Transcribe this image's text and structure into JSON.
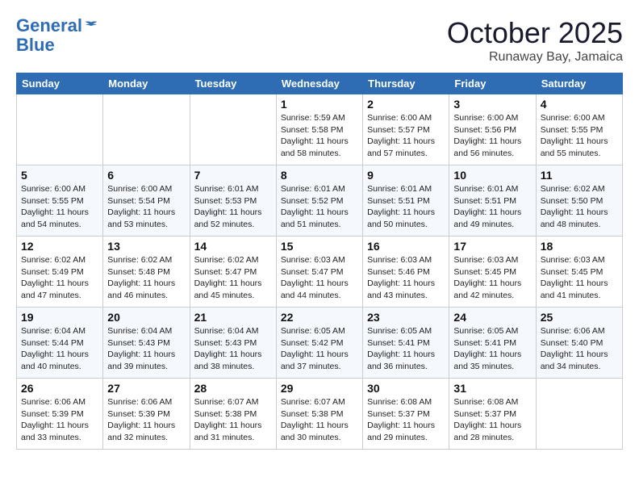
{
  "header": {
    "logo_line1": "General",
    "logo_line2": "Blue",
    "month": "October 2025",
    "location": "Runaway Bay, Jamaica"
  },
  "weekdays": [
    "Sunday",
    "Monday",
    "Tuesday",
    "Wednesday",
    "Thursday",
    "Friday",
    "Saturday"
  ],
  "weeks": [
    [
      {
        "day": "",
        "info": ""
      },
      {
        "day": "",
        "info": ""
      },
      {
        "day": "",
        "info": ""
      },
      {
        "day": "1",
        "info": "Sunrise: 5:59 AM\nSunset: 5:58 PM\nDaylight: 11 hours and 58 minutes."
      },
      {
        "day": "2",
        "info": "Sunrise: 6:00 AM\nSunset: 5:57 PM\nDaylight: 11 hours and 57 minutes."
      },
      {
        "day": "3",
        "info": "Sunrise: 6:00 AM\nSunset: 5:56 PM\nDaylight: 11 hours and 56 minutes."
      },
      {
        "day": "4",
        "info": "Sunrise: 6:00 AM\nSunset: 5:55 PM\nDaylight: 11 hours and 55 minutes."
      }
    ],
    [
      {
        "day": "5",
        "info": "Sunrise: 6:00 AM\nSunset: 5:55 PM\nDaylight: 11 hours and 54 minutes."
      },
      {
        "day": "6",
        "info": "Sunrise: 6:00 AM\nSunset: 5:54 PM\nDaylight: 11 hours and 53 minutes."
      },
      {
        "day": "7",
        "info": "Sunrise: 6:01 AM\nSunset: 5:53 PM\nDaylight: 11 hours and 52 minutes."
      },
      {
        "day": "8",
        "info": "Sunrise: 6:01 AM\nSunset: 5:52 PM\nDaylight: 11 hours and 51 minutes."
      },
      {
        "day": "9",
        "info": "Sunrise: 6:01 AM\nSunset: 5:51 PM\nDaylight: 11 hours and 50 minutes."
      },
      {
        "day": "10",
        "info": "Sunrise: 6:01 AM\nSunset: 5:51 PM\nDaylight: 11 hours and 49 minutes."
      },
      {
        "day": "11",
        "info": "Sunrise: 6:02 AM\nSunset: 5:50 PM\nDaylight: 11 hours and 48 minutes."
      }
    ],
    [
      {
        "day": "12",
        "info": "Sunrise: 6:02 AM\nSunset: 5:49 PM\nDaylight: 11 hours and 47 minutes."
      },
      {
        "day": "13",
        "info": "Sunrise: 6:02 AM\nSunset: 5:48 PM\nDaylight: 11 hours and 46 minutes."
      },
      {
        "day": "14",
        "info": "Sunrise: 6:02 AM\nSunset: 5:47 PM\nDaylight: 11 hours and 45 minutes."
      },
      {
        "day": "15",
        "info": "Sunrise: 6:03 AM\nSunset: 5:47 PM\nDaylight: 11 hours and 44 minutes."
      },
      {
        "day": "16",
        "info": "Sunrise: 6:03 AM\nSunset: 5:46 PM\nDaylight: 11 hours and 43 minutes."
      },
      {
        "day": "17",
        "info": "Sunrise: 6:03 AM\nSunset: 5:45 PM\nDaylight: 11 hours and 42 minutes."
      },
      {
        "day": "18",
        "info": "Sunrise: 6:03 AM\nSunset: 5:45 PM\nDaylight: 11 hours and 41 minutes."
      }
    ],
    [
      {
        "day": "19",
        "info": "Sunrise: 6:04 AM\nSunset: 5:44 PM\nDaylight: 11 hours and 40 minutes."
      },
      {
        "day": "20",
        "info": "Sunrise: 6:04 AM\nSunset: 5:43 PM\nDaylight: 11 hours and 39 minutes."
      },
      {
        "day": "21",
        "info": "Sunrise: 6:04 AM\nSunset: 5:43 PM\nDaylight: 11 hours and 38 minutes."
      },
      {
        "day": "22",
        "info": "Sunrise: 6:05 AM\nSunset: 5:42 PM\nDaylight: 11 hours and 37 minutes."
      },
      {
        "day": "23",
        "info": "Sunrise: 6:05 AM\nSunset: 5:41 PM\nDaylight: 11 hours and 36 minutes."
      },
      {
        "day": "24",
        "info": "Sunrise: 6:05 AM\nSunset: 5:41 PM\nDaylight: 11 hours and 35 minutes."
      },
      {
        "day": "25",
        "info": "Sunrise: 6:06 AM\nSunset: 5:40 PM\nDaylight: 11 hours and 34 minutes."
      }
    ],
    [
      {
        "day": "26",
        "info": "Sunrise: 6:06 AM\nSunset: 5:39 PM\nDaylight: 11 hours and 33 minutes."
      },
      {
        "day": "27",
        "info": "Sunrise: 6:06 AM\nSunset: 5:39 PM\nDaylight: 11 hours and 32 minutes."
      },
      {
        "day": "28",
        "info": "Sunrise: 6:07 AM\nSunset: 5:38 PM\nDaylight: 11 hours and 31 minutes."
      },
      {
        "day": "29",
        "info": "Sunrise: 6:07 AM\nSunset: 5:38 PM\nDaylight: 11 hours and 30 minutes."
      },
      {
        "day": "30",
        "info": "Sunrise: 6:08 AM\nSunset: 5:37 PM\nDaylight: 11 hours and 29 minutes."
      },
      {
        "day": "31",
        "info": "Sunrise: 6:08 AM\nSunset: 5:37 PM\nDaylight: 11 hours and 28 minutes."
      },
      {
        "day": "",
        "info": ""
      }
    ]
  ]
}
